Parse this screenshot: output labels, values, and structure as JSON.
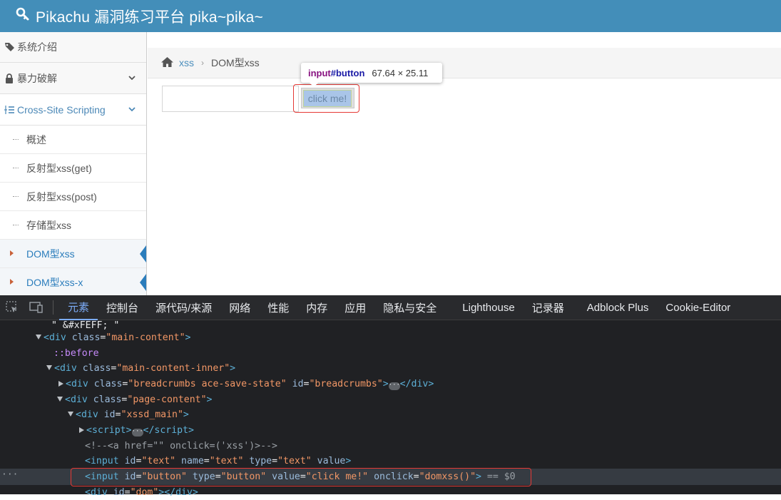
{
  "header": {
    "title": "Pikachu 漏洞练习平台 pika~pika~",
    "icon": "wrench-icon"
  },
  "sidebar": {
    "items": [
      {
        "label": "系统介绍",
        "icon": "tags-icon"
      },
      {
        "label": "暴力破解",
        "icon": "lock-icon"
      },
      {
        "label": "Cross-Site Scripting",
        "icon": "list-icon"
      }
    ],
    "sub_items": [
      {
        "label": "概述"
      },
      {
        "label": "反射型xss(get)"
      },
      {
        "label": "反射型xss(post)"
      },
      {
        "label": "存储型xss"
      },
      {
        "label": "DOM型xss"
      },
      {
        "label": "DOM型xss-x"
      }
    ]
  },
  "breadcrumbs": {
    "link": "xss",
    "current": "DOM型xss"
  },
  "main": {
    "text_input_value": "",
    "button_label": "click me!"
  },
  "tooltip": {
    "tag": "input",
    "id": "#button",
    "dims": "67.64 × 25.11"
  },
  "devtools": {
    "tabs": [
      "元素",
      "控制台",
      "源代码/来源",
      "网络",
      "性能",
      "内存",
      "应用",
      "隐私与安全",
      "Lighthouse",
      "记录器",
      "Adblock Plus",
      "Cookie-Editor"
    ],
    "active_tab": "元素",
    "lines": {
      "l0": "\" &#xFEFF; \"",
      "l3_pre": "<div class=\"breadcrumbs ace-save-state\" id=\"breadcrumbs\">",
      "selected_suffix": "== $0"
    }
  },
  "colors": {
    "header_bg": "#438eb9",
    "accent": "#2b7dbc",
    "highlight_red": "#e53935"
  }
}
